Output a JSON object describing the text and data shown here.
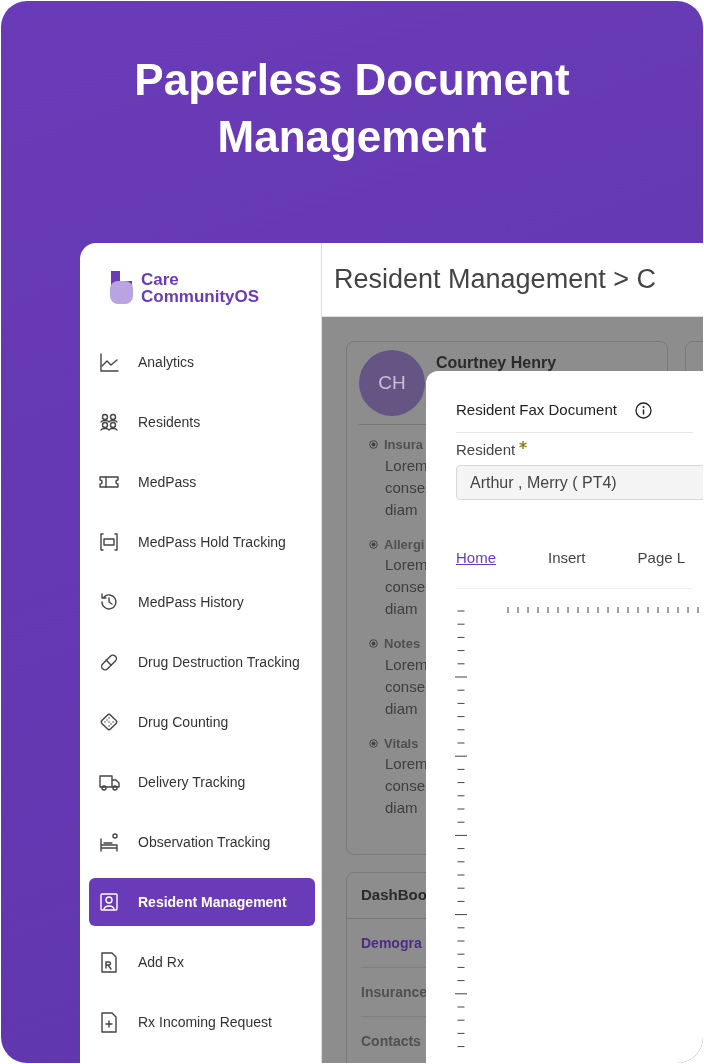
{
  "headline": "Paperless Document Management",
  "brand": {
    "line1": "Care",
    "line2": "CommunityOS"
  },
  "sidebar": {
    "items": [
      {
        "label": "Analytics",
        "selected": false
      },
      {
        "label": "Residents",
        "selected": false
      },
      {
        "label": "MedPass",
        "selected": false
      },
      {
        "label": "MedPass Hold Tracking",
        "selected": false
      },
      {
        "label": "MedPass History",
        "selected": false
      },
      {
        "label": "Drug Destruction Tracking",
        "selected": false
      },
      {
        "label": "Drug Counting",
        "selected": false
      },
      {
        "label": "Delivery Tracking",
        "selected": false
      },
      {
        "label": "Observation Tracking",
        "selected": false
      },
      {
        "label": "Resident Management",
        "selected": true
      },
      {
        "label": "Add Rx",
        "selected": false
      },
      {
        "label": "Rx Incoming Request",
        "selected": false
      }
    ]
  },
  "header": {
    "title": "Resident Management > C"
  },
  "profile": {
    "initials": "CH",
    "name": "Courtney Henry",
    "sections": [
      {
        "heading": "Insura",
        "lines": [
          "Lorem",
          "conse",
          "diam"
        ]
      },
      {
        "heading": "Allergi",
        "lines": [
          "Lorem",
          "conse",
          "diam"
        ]
      },
      {
        "heading": "Notes",
        "lines": [
          "Lorem",
          "conse",
          "diam"
        ]
      },
      {
        "heading": "Vitals",
        "lines": [
          "Lorem",
          "conse",
          "diam"
        ]
      }
    ]
  },
  "dashboard": {
    "title": "DashBoo",
    "items": [
      {
        "label": "Demogra",
        "selected": true
      },
      {
        "label": "Insurance",
        "selected": false
      },
      {
        "label": "Contacts",
        "selected": false
      }
    ]
  },
  "modal": {
    "title": "Resident Fax Document",
    "field": {
      "label": "Resident",
      "required": true,
      "value": "Arthur , Merry ( PT4)"
    },
    "tabs": [
      {
        "label": "Home",
        "selected": true
      },
      {
        "label": "Insert",
        "selected": false
      },
      {
        "label": "Page L",
        "selected": false
      }
    ]
  }
}
